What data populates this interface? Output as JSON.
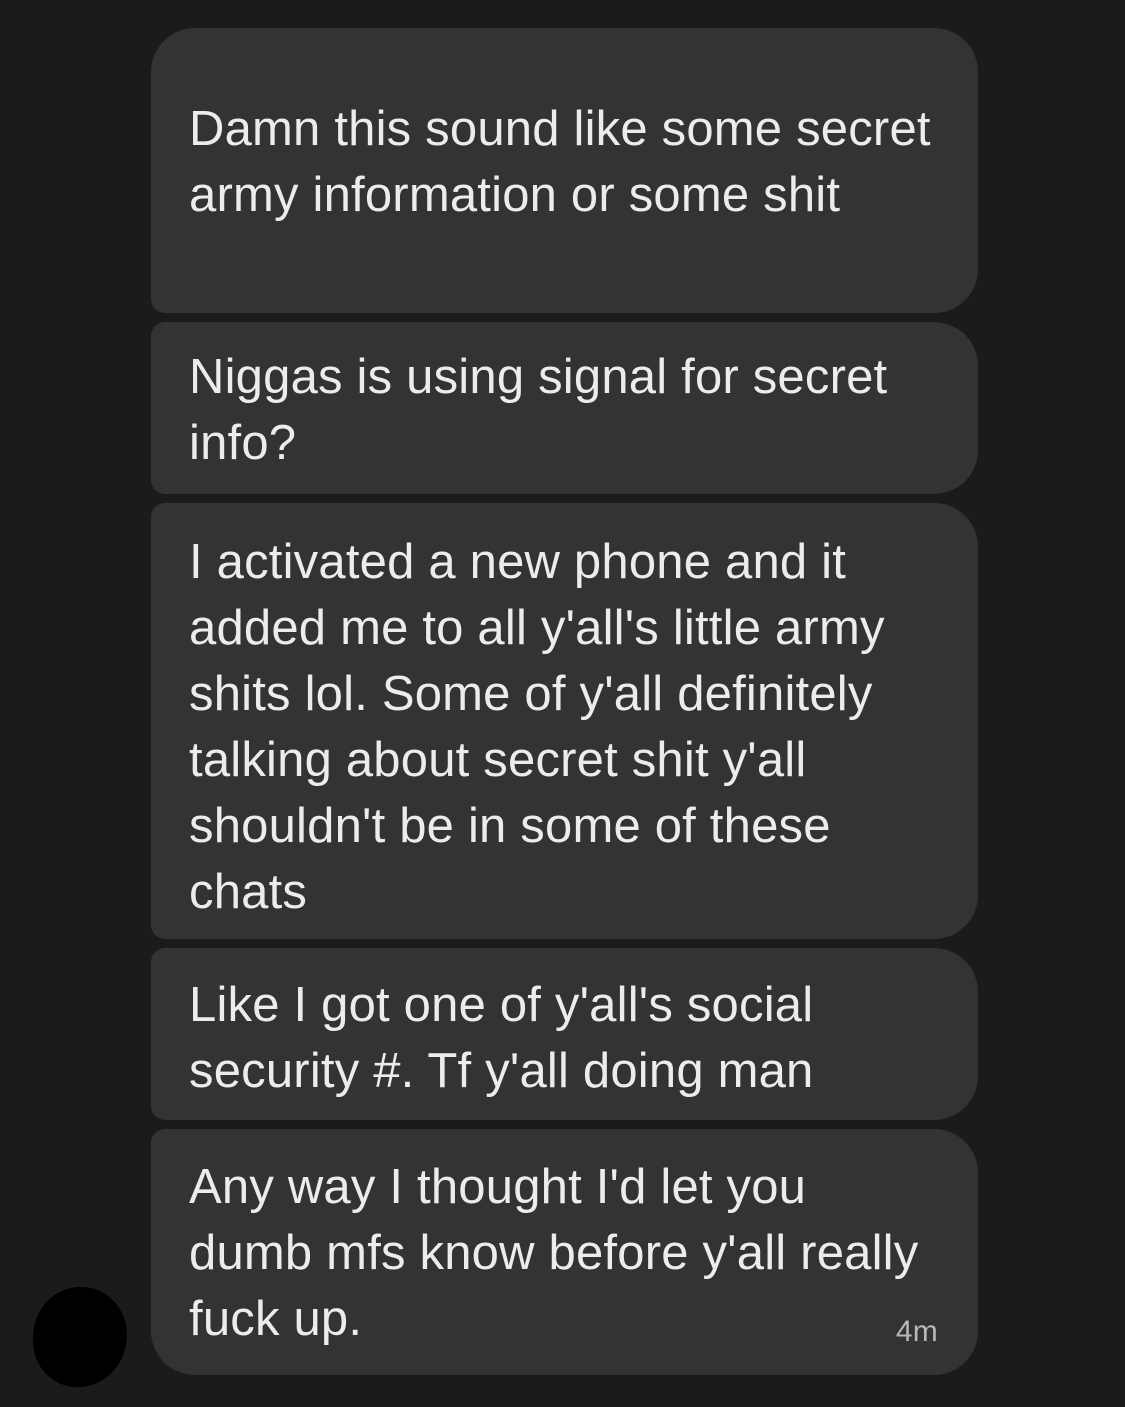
{
  "conversation": {
    "messages": [
      {
        "text": "Damn this sound like some secret army information or some shit"
      },
      {
        "text": "Niggas is using signal for secret info?"
      },
      {
        "text": "I activated a new phone and it added me to all y'all's little army shits lol. Some of y'all definitely talking about secret shit y'all shouldn't be in some of these chats"
      },
      {
        "text": "Like I got one of y'all's social security #. Tf y'all doing man"
      },
      {
        "text": "Any way I thought I'd let you dumb mfs know before y'all really fuck up.",
        "time": "4m"
      }
    ]
  },
  "colors": {
    "background": "#1b1b1d",
    "bubble": "#333335",
    "text": "#ececec",
    "timestamp": "#b8b8ba"
  },
  "icons": {
    "avatar": "redacted-avatar"
  }
}
